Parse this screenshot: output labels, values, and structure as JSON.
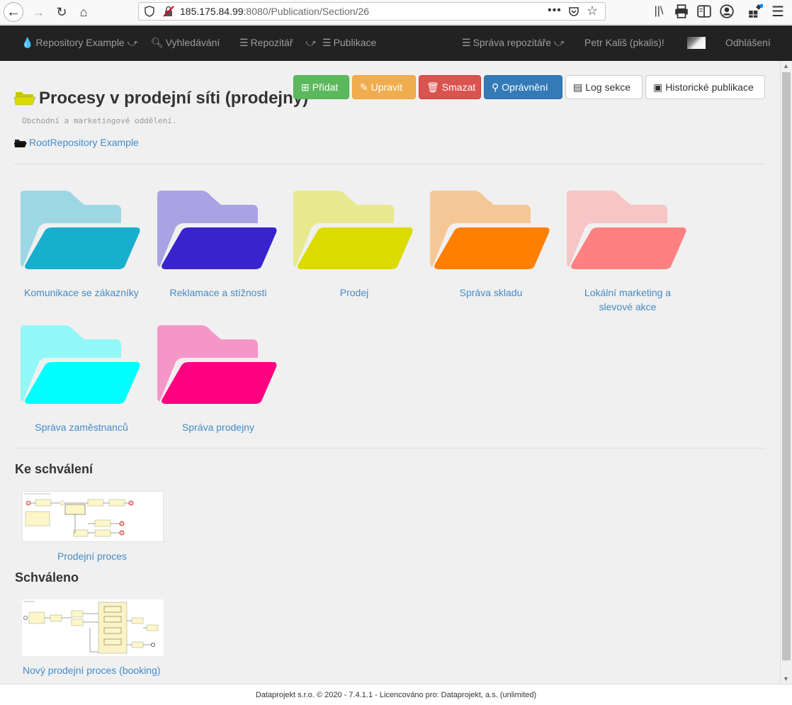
{
  "browser": {
    "url_host": "185.175.84.99",
    "url_rest": ":8080/Publication/Section/26",
    "more": "•••"
  },
  "navbar": {
    "brand": "Repository Example",
    "search": "Vyhledávání",
    "repository": "Repozitář",
    "publications": "Publikace",
    "repo_admin": "Správa repozitáře",
    "user": "Petr Kališ (pkalis)!",
    "logout": "Odhlášení"
  },
  "page": {
    "title": "Procesy v prodejní síti (prodejny)",
    "description": "Obchodní a marketingové oddělení.",
    "breadcrumb": "RootRepository Example"
  },
  "actions": {
    "add": "Přidat",
    "edit": "Upravit",
    "delete": "Smazat",
    "permissions": "Oprávnění",
    "log": "Log sekce",
    "history": "Historické publikace"
  },
  "folders": [
    {
      "label": "Komunikace se zákazníky",
      "back": "#9ed7e4",
      "front": "#17afcd"
    },
    {
      "label": "Reklamace a stížnosti",
      "back": "#a9a3e4",
      "front": "#3823cc"
    },
    {
      "label": "Prodej",
      "back": "#e8e88e",
      "front": "#dbdb00"
    },
    {
      "label": "Správa skladu",
      "back": "#f6c796",
      "front": "#ff7f00"
    },
    {
      "label": "Lokální marketing a slevové akce",
      "back": "#f6c5c6",
      "front": "#ff8080"
    },
    {
      "label": "Správa zaměstnanců",
      "back": "#93f7f7",
      "front": "#00ffff"
    },
    {
      "label": "Správa prodejny",
      "back": "#f596c9",
      "front": "#ff0080"
    }
  ],
  "pending": {
    "heading": "Ke schválení",
    "items": [
      {
        "label": "Prodejní proces"
      }
    ]
  },
  "approved": {
    "heading": "Schváleno",
    "items": [
      {
        "label": "Nový prodejní proces (booking)"
      }
    ]
  },
  "footer": "Dataprojekt s.r.o. © 2020 - 7.4.1.1 - Licencováno pro: Dataprojekt, a.s. (unlimited)"
}
